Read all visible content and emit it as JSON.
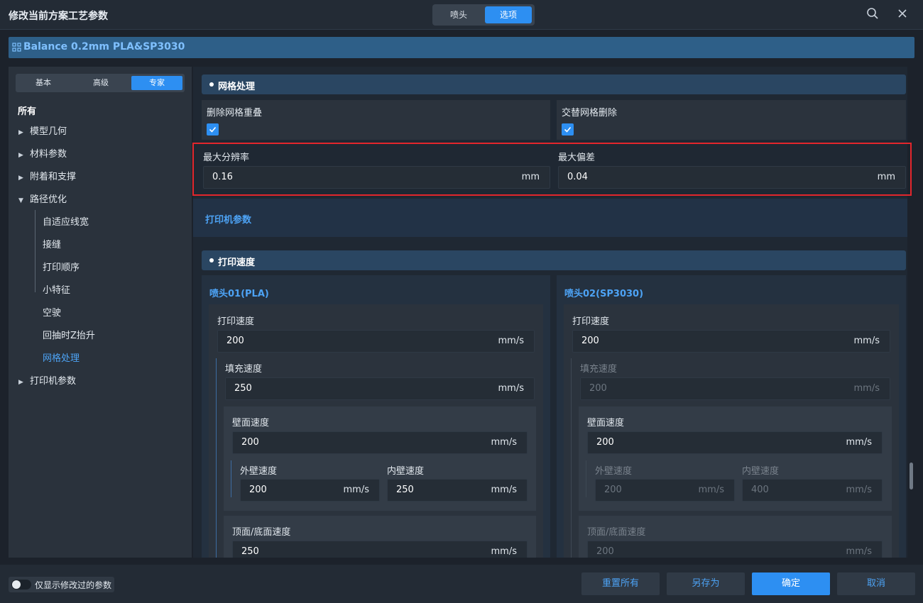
{
  "window": {
    "title": "修改当前方案工艺参数",
    "tabs": [
      {
        "label": "喷头",
        "active": false
      },
      {
        "label": "选项",
        "active": true
      }
    ],
    "search_icon": "search-icon",
    "close_icon": "close-icon"
  },
  "profile": {
    "name": "Balance 0.2mm PLA&SP3030",
    "icon": "grid-icon"
  },
  "sidebar": {
    "modes": [
      {
        "label": "基本",
        "active": false
      },
      {
        "label": "高级",
        "active": false
      },
      {
        "label": "专家",
        "active": true
      }
    ],
    "root": "所有",
    "items": [
      {
        "label": "模型几何",
        "expanded": false
      },
      {
        "label": "材料参数",
        "expanded": false
      },
      {
        "label": "附着和支撑",
        "expanded": false
      },
      {
        "label": "路径优化",
        "expanded": true
      },
      {
        "label": "打印机参数",
        "expanded": false
      }
    ],
    "sub_items": [
      {
        "label": "自适应线宽",
        "selected": false
      },
      {
        "label": "接缝",
        "selected": false
      },
      {
        "label": "打印顺序",
        "selected": false
      },
      {
        "label": "小特征",
        "selected": false
      },
      {
        "label": "空驶",
        "selected": false
      },
      {
        "label": "回抽时Z抬升",
        "selected": false
      },
      {
        "label": "网格处理",
        "selected": true
      }
    ]
  },
  "mesh": {
    "title": "网格处理",
    "remove_overlap": {
      "label": "删除网格重叠",
      "checked": true
    },
    "alternate_removal": {
      "label": "交替网格删除",
      "checked": true
    },
    "max_resolution": {
      "label": "最大分辨率",
      "value": "0.16",
      "unit": "mm"
    },
    "max_deviation": {
      "label": "最大偏差",
      "value": "0.04",
      "unit": "mm"
    }
  },
  "printer_params": {
    "title": "打印机参数"
  },
  "speed": {
    "title": "打印速度",
    "nozzles": [
      {
        "name": "喷头01(PLA)",
        "print_speed": {
          "label": "打印速度",
          "value": "200",
          "unit": "mm/s"
        },
        "infill_speed": {
          "label": "填充速度",
          "value": "250",
          "unit": "mm/s"
        },
        "wall_speed": {
          "label": "壁面速度",
          "value": "200",
          "unit": "mm/s"
        },
        "outer_wall": {
          "label": "外壁速度",
          "value": "200",
          "unit": "mm/s"
        },
        "inner_wall": {
          "label": "内壁速度",
          "value": "250",
          "unit": "mm/s"
        },
        "top_bottom": {
          "label": "顶面/底面速度",
          "value": "250",
          "unit": "mm/s"
        }
      },
      {
        "name": "喷头02(SP3030)",
        "print_speed": {
          "label": "打印速度",
          "value": "200",
          "unit": "mm/s"
        },
        "infill_speed": {
          "label": "填充速度",
          "value": "200",
          "unit": "mm/s"
        },
        "wall_speed": {
          "label": "壁面速度",
          "value": "200",
          "unit": "mm/s"
        },
        "outer_wall": {
          "label": "外壁速度",
          "value": "200",
          "unit": "mm/s"
        },
        "inner_wall": {
          "label": "内壁速度",
          "value": "400",
          "unit": "mm/s"
        },
        "top_bottom": {
          "label": "顶面/底面速度",
          "value": "200",
          "unit": "mm/s"
        }
      }
    ]
  },
  "footer": {
    "toggle_label": "仅显示修改过的参数",
    "toggle_on": false,
    "reset_all": "重置所有",
    "save_as": "另存为",
    "confirm": "确定",
    "cancel": "取消"
  },
  "colors": {
    "accent": "#2d8ff2",
    "link": "#4da3f5",
    "highlight_box": "#e3262c"
  }
}
